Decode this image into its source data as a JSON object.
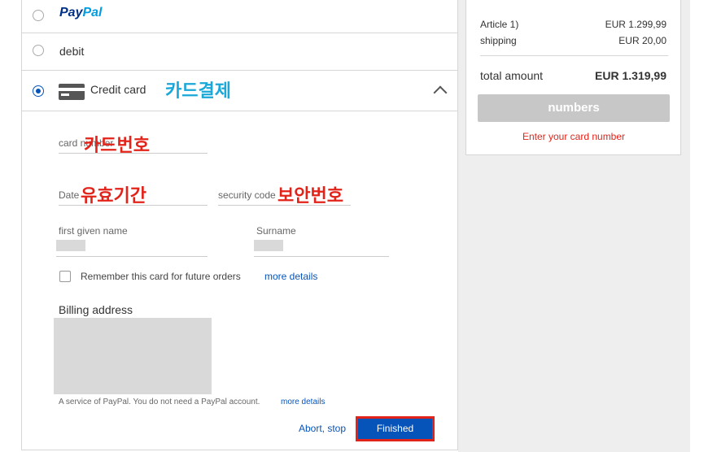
{
  "payment": {
    "paypal": {
      "pay": "Pay",
      "pal": "Pal"
    },
    "debit_label": "debit",
    "credit_label": "Credit card",
    "credit_annotation": "카드결제",
    "card_number": {
      "label": "card number",
      "annotation": "카드번호"
    },
    "expiry": {
      "label": "Date",
      "annotation": "유효기간"
    },
    "security": {
      "label": "security code",
      "annotation": "보안번호"
    },
    "first_name_label": "first given name",
    "surname_label": "Surname",
    "remember_label": "Remember this card for future orders",
    "more_details": "more details",
    "billing_title": "Billing address",
    "service_note": "A service of PayPal. You do not need a PayPal account.",
    "service_more": "more details",
    "abort_label": "Abort, stop",
    "finished_label": "Finished"
  },
  "summary": {
    "rows": [
      {
        "label": "Article 1)",
        "value": "EUR 1.299,99"
      },
      {
        "label": "shipping",
        "value": "EUR 20,00"
      }
    ],
    "total_label": "total amount",
    "total_value": "EUR 1.319,99",
    "button_label": "numbers",
    "error": "Enter your card number"
  }
}
